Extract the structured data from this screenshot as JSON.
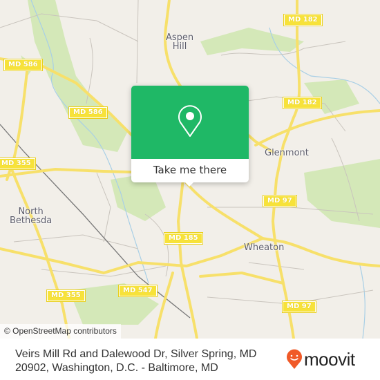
{
  "map": {
    "place_labels": [
      {
        "text": "Aspen\nHill"
      },
      {
        "text": "Glenmont"
      },
      {
        "text": "North\nBethesda"
      },
      {
        "text": "Wheaton"
      }
    ],
    "route_shields": [
      "MD 586",
      "MD 586",
      "MD 182",
      "MD 182",
      "MD 355",
      "MD 355",
      "MD 185",
      "MD 547",
      "MD 97",
      "MD 97"
    ],
    "colors": {
      "land": "#f2efe9",
      "park": "#d4e8b8",
      "road_major": "#f7e06a",
      "road_minor": "#c9c4bd",
      "water": "#a8cfe6",
      "rail": "#777777"
    }
  },
  "callout": {
    "button_label": "Take me there",
    "icon": "map-pin-icon",
    "color": "#1fb866"
  },
  "attribution": "© OpenStreetMap contributors",
  "footer": {
    "address": "Veirs Mill Rd and Dalewood Dr, Silver Spring, MD 20902, Washington, D.C. - Baltimore, MD",
    "brand": "moovit",
    "brand_color": "#f05a28"
  }
}
